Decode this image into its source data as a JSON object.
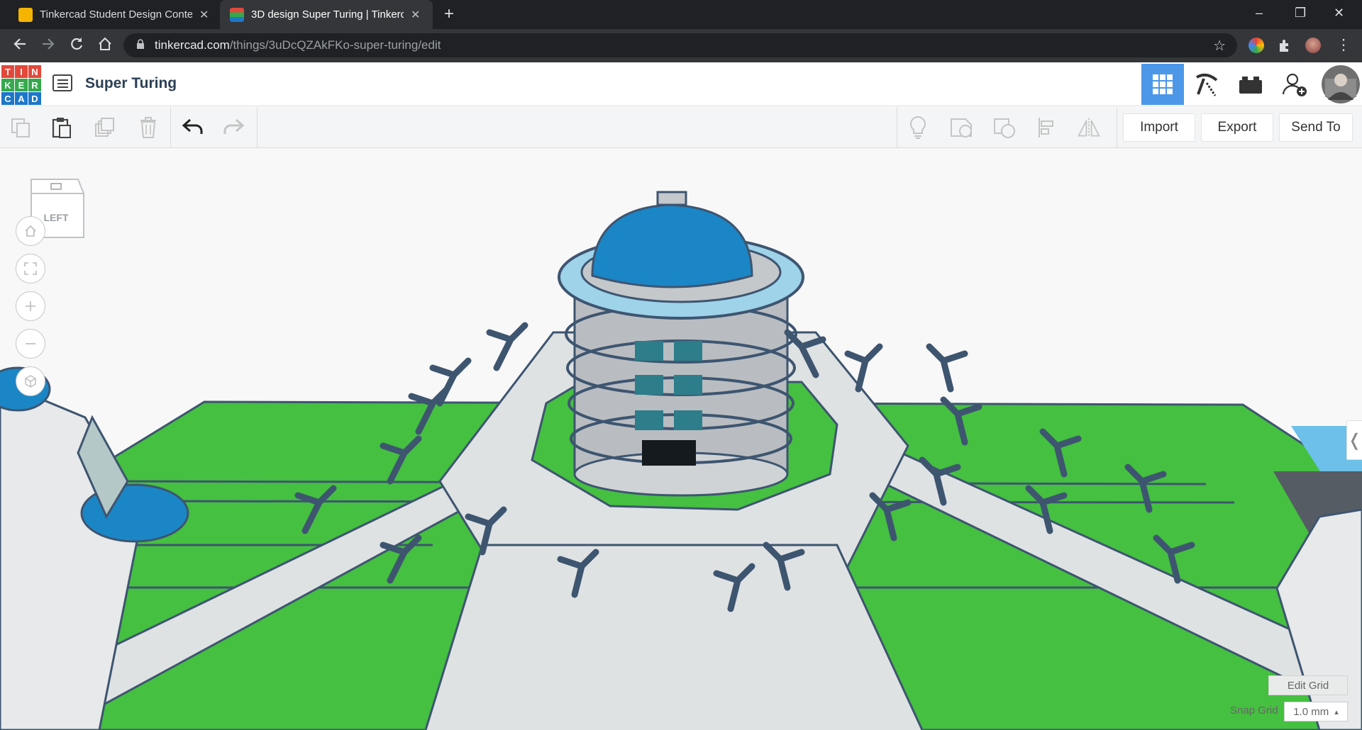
{
  "browser": {
    "tabs": [
      {
        "title": "Tinkercad Student Design Conte",
        "close": "✕",
        "active": false
      },
      {
        "title": "3D design Super Turing | Tinkerc",
        "close": "✕",
        "active": true
      }
    ],
    "new_tab": "+",
    "window_controls": {
      "minimize": "–",
      "maximize": "❐",
      "close": "✕"
    },
    "url_domain": "tinkercad.com",
    "url_path": "/things/3uDcQZAkFKo-super-turing/edit"
  },
  "app": {
    "logo_letters": [
      "T",
      "I",
      "N",
      "K",
      "E",
      "R",
      "C",
      "A",
      "D"
    ],
    "logo_colors": [
      "#e4483b",
      "#e4483b",
      "#e4483b",
      "#35a94c",
      "#35a94c",
      "#35a94c",
      "#1d77c9",
      "#1d77c9",
      "#1d77c9"
    ],
    "design_title": "Super Turing",
    "header_buttons": [
      "grid-view-icon",
      "pickaxe-icon",
      "bricks-icon",
      "add-user-icon",
      "avatar"
    ],
    "accent_color": "#4c97e8"
  },
  "toolbar": {
    "import_label": "Import",
    "export_label": "Export",
    "send_to_label": "Send To"
  },
  "workplane": {
    "viewcube_label": "LEFT",
    "edit_grid_label": "Edit Grid",
    "snap_grid_label": "Snap Grid",
    "snap_grid_value": "1.0 mm",
    "snap_grid_arrow": "▴",
    "panel_handle": "❬",
    "grass_color": "#45c040",
    "plaza_color": "#dfe2e3",
    "dome_color": "#1b86c6",
    "tree_color": "#3e5570"
  }
}
